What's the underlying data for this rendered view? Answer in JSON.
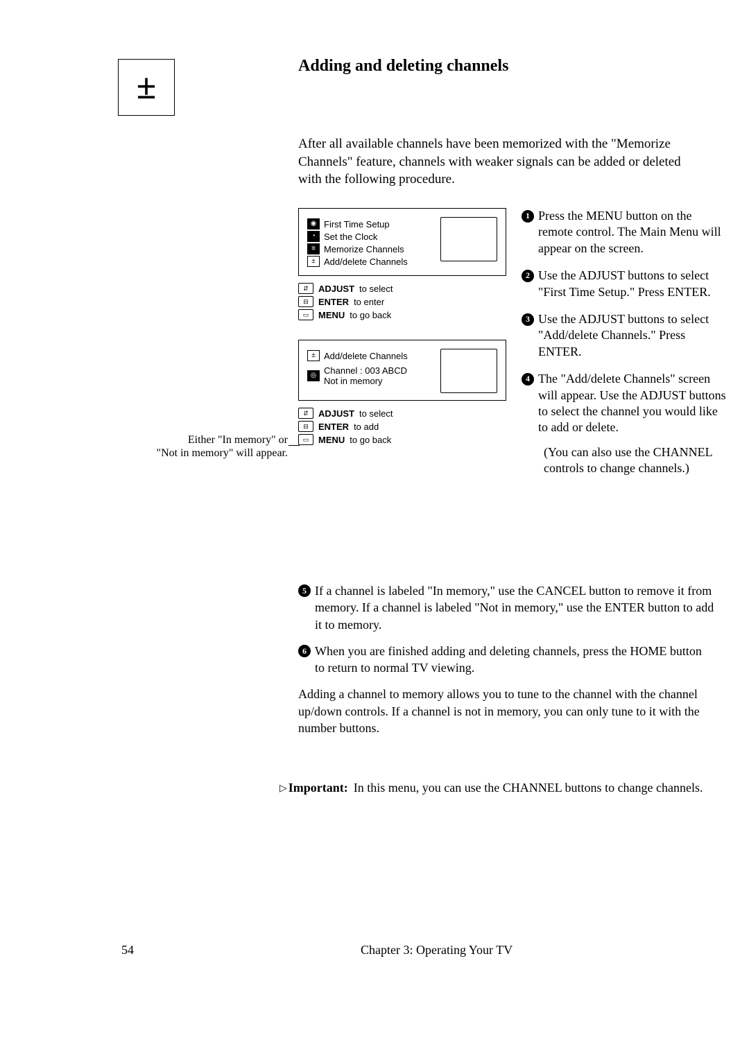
{
  "title": "Adding and deleting channels",
  "intro": "After all available channels have been memorized with the \"Memorize Channels\" feature, channels with weaker signals can be added or deleted with the following procedure.",
  "panel1": {
    "item1": "First Time Setup",
    "item2": "Set the Clock",
    "item3": "Memorize Channels",
    "item4": "Add/delete Channels"
  },
  "hints1": {
    "adjust_label": "ADJUST",
    "adjust_txt": "to select",
    "enter_label": "ENTER",
    "enter_txt": "to enter",
    "menu_label": "MENU",
    "menu_txt": "to go back"
  },
  "panel2": {
    "title": "Add/delete Channels",
    "line1": "Channel    : 003 ABCD",
    "line2": "Not in memory"
  },
  "hints2": {
    "adjust_label": "ADJUST",
    "adjust_txt": "to select",
    "enter_label": "ENTER",
    "enter_txt": "to add",
    "menu_label": "MENU",
    "menu_txt": "to go back"
  },
  "arrow_label_a": "Either \"In memory\" or",
  "arrow_label_b": "\"Not in memory\" will appear.",
  "steps": {
    "s1": "Press the MENU button on the remote control. The Main Menu will appear on the screen.",
    "s2": "Use the ADJUST buttons to select \"First Time Setup.\" Press ENTER.",
    "s3": "Use the ADJUST buttons to select \"Add/delete Channels.\" Press ENTER.",
    "s4": "The \"Add/delete Channels\" screen will appear. Use the ADJUST buttons to select the channel you would like to add or delete.",
    "s4b": "(You can also use the CHANNEL controls to change channels.)",
    "s5": "If a channel is labeled \"In memory,\" use the CANCEL button to remove it from memory. If a channel is labeled \"Not in memory,\" use the ENTER button to add it to memory.",
    "s6": "When you are finished adding and deleting channels, press the HOME button to return to normal TV viewing."
  },
  "tail": "Adding a channel to memory allows you to tune to the channel with the channel up/down controls. If a channel is not in memory, you can only tune to it with the number buttons.",
  "important_label": "Important:",
  "important_text": "In this menu, you can use the CHANNEL buttons to change channels.",
  "footer_page": "54",
  "footer_chapter": "Chapter 3: Operating Your TV"
}
